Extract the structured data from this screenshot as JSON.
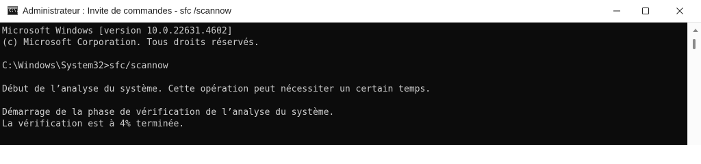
{
  "window": {
    "title": "Administrateur : Invite de commandes - sfc /scannow",
    "icon": "cmd-icon",
    "icon_label": "C:\\."
  },
  "controls": {
    "minimize_icon": "minimize-icon",
    "maximize_icon": "maximize-icon",
    "close_icon": "close-icon"
  },
  "console": {
    "lines": [
      "Microsoft Windows [version 10.0.22631.4602]",
      "(c) Microsoft Corporation. Tous droits réservés.",
      "C:\\Windows\\System32>sfc/scannow",
      "Début de l’analyse du système. Cette opération peut nécessiter un certain temps.",
      "Démarrage de la phase de vérification de l’analyse du système.",
      "La vérification est à 4% terminée."
    ],
    "progress_percent": 4
  },
  "colors": {
    "console_background": "#0c0c0c",
    "console_text": "#cccccc",
    "titlebar_background": "#ffffff"
  }
}
